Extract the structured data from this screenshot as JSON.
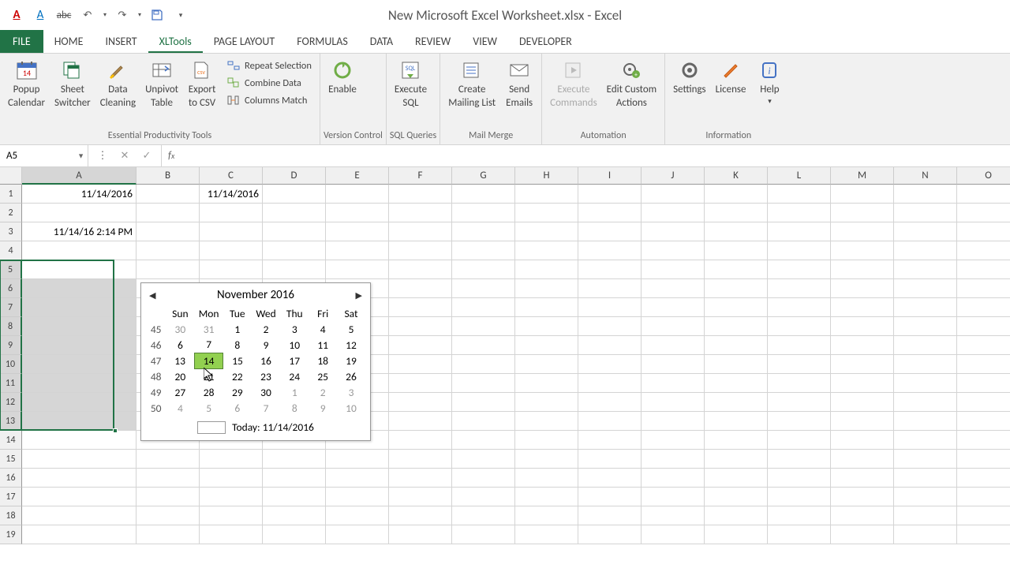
{
  "window": {
    "title": "New Microsoft Excel Worksheet.xlsx - Excel"
  },
  "tabs": {
    "file": "FILE",
    "items": [
      "HOME",
      "INSERT",
      "XLTools",
      "PAGE LAYOUT",
      "FORMULAS",
      "DATA",
      "REVIEW",
      "VIEW",
      "DEVELOPER"
    ],
    "active": "XLTools"
  },
  "ribbon": {
    "g1": {
      "label": "Essential Productivity Tools",
      "btns": [
        {
          "l1": "Popup",
          "l2": "Calendar"
        },
        {
          "l1": "Sheet",
          "l2": "Switcher"
        },
        {
          "l1": "Data",
          "l2": "Cleaning"
        },
        {
          "l1": "Unpivot",
          "l2": "Table"
        },
        {
          "l1": "Export",
          "l2": "to CSV"
        }
      ],
      "small": [
        "Repeat Selection",
        "Combine Data",
        "Columns Match"
      ]
    },
    "g2": {
      "label": "Version Control",
      "btn": {
        "l1": "Enable",
        "l2": ""
      }
    },
    "g3": {
      "label": "SQL Queries",
      "btn": {
        "l1": "Execute",
        "l2": "SQL"
      }
    },
    "g4": {
      "label": "Mail Merge",
      "btns": [
        {
          "l1": "Create",
          "l2": "Mailing List"
        },
        {
          "l1": "Send",
          "l2": "Emails"
        }
      ]
    },
    "g5": {
      "label": "Automation",
      "btns": [
        {
          "l1": "Execute",
          "l2": "Commands"
        },
        {
          "l1": "Edit Custom",
          "l2": "Actions"
        }
      ]
    },
    "g6": {
      "label": "Information",
      "btns": [
        {
          "l1": "Settings",
          "l2": ""
        },
        {
          "l1": "License",
          "l2": ""
        },
        {
          "l1": "Help",
          "l2": "▾"
        }
      ]
    }
  },
  "namebox": "A5",
  "cols": [
    "A",
    "B",
    "C",
    "D",
    "E",
    "F",
    "G",
    "H",
    "I",
    "J",
    "K",
    "L",
    "M",
    "N",
    "O"
  ],
  "rows": [
    "1",
    "2",
    "3",
    "4",
    "5",
    "6",
    "7",
    "8",
    "9",
    "10",
    "11",
    "12",
    "13",
    "14",
    "15",
    "16",
    "17",
    "18",
    "19"
  ],
  "selRows": [
    5,
    6,
    7,
    8,
    9,
    10,
    11,
    12,
    13
  ],
  "cells": {
    "A1": "11/14/2016",
    "C1": "11/14/2016",
    "A3": "11/14/16 2:14 PM"
  },
  "calendar": {
    "month": "November 2016",
    "dow": [
      "Sun",
      "Mon",
      "Tue",
      "Wed",
      "Thu",
      "Fri",
      "Sat"
    ],
    "weeks": [
      {
        "wk": "45",
        "d": [
          {
            "n": "30",
            "o": 1
          },
          {
            "n": "31",
            "o": 1
          },
          {
            "n": "1"
          },
          {
            "n": "2"
          },
          {
            "n": "3"
          },
          {
            "n": "4"
          },
          {
            "n": "5"
          }
        ]
      },
      {
        "wk": "46",
        "d": [
          {
            "n": "6"
          },
          {
            "n": "7"
          },
          {
            "n": "8"
          },
          {
            "n": "9"
          },
          {
            "n": "10"
          },
          {
            "n": "11"
          },
          {
            "n": "12"
          }
        ]
      },
      {
        "wk": "47",
        "d": [
          {
            "n": "13"
          },
          {
            "n": "14",
            "t": 1
          },
          {
            "n": "15"
          },
          {
            "n": "16"
          },
          {
            "n": "17"
          },
          {
            "n": "18"
          },
          {
            "n": "19"
          }
        ]
      },
      {
        "wk": "48",
        "d": [
          {
            "n": "20"
          },
          {
            "n": "21"
          },
          {
            "n": "22"
          },
          {
            "n": "23"
          },
          {
            "n": "24"
          },
          {
            "n": "25"
          },
          {
            "n": "26"
          }
        ]
      },
      {
        "wk": "49",
        "d": [
          {
            "n": "27"
          },
          {
            "n": "28"
          },
          {
            "n": "29"
          },
          {
            "n": "30"
          },
          {
            "n": "1",
            "o": 1
          },
          {
            "n": "2",
            "o": 1
          },
          {
            "n": "3",
            "o": 1
          }
        ]
      },
      {
        "wk": "50",
        "d": [
          {
            "n": "4",
            "o": 1
          },
          {
            "n": "5",
            "o": 1
          },
          {
            "n": "6",
            "o": 1
          },
          {
            "n": "7",
            "o": 1
          },
          {
            "n": "8",
            "o": 1
          },
          {
            "n": "9",
            "o": 1
          },
          {
            "n": "10",
            "o": 1
          }
        ]
      }
    ],
    "today": "Today: 11/14/2016"
  }
}
